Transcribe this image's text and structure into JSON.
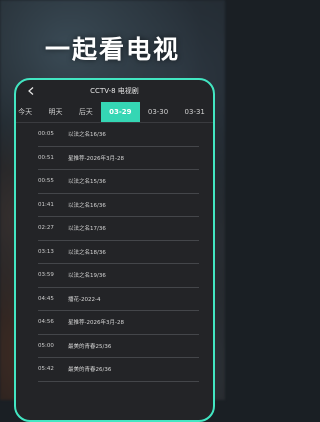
{
  "headline": "一起看电视",
  "header": {
    "title": "CCTV-8 电视剧"
  },
  "colors": {
    "accent": "#35d6b4",
    "border": "#42e6c2"
  },
  "tabs": [
    {
      "label": "今天"
    },
    {
      "label": "明天"
    },
    {
      "label": "后天"
    },
    {
      "label": "03-29",
      "active": true
    },
    {
      "label": "03-30"
    },
    {
      "label": "03-31"
    }
  ],
  "programs": [
    {
      "time": "00:05",
      "title": "以法之名16/36"
    },
    {
      "time": "00:51",
      "title": "星推荐-2026年3月-28"
    },
    {
      "time": "00:55",
      "title": "以法之名15/36"
    },
    {
      "time": "01:41",
      "title": "以法之名16/36"
    },
    {
      "time": "02:27",
      "title": "以法之名17/36"
    },
    {
      "time": "03:13",
      "title": "以法之名18/36"
    },
    {
      "time": "03:59",
      "title": "以法之名19/36"
    },
    {
      "time": "04:45",
      "title": "播花-2022-4"
    },
    {
      "time": "04:56",
      "title": "星推荐-2026年3月-28"
    },
    {
      "time": "05:00",
      "title": "最美的青春25/36"
    },
    {
      "time": "05:42",
      "title": "最美的青春26/36"
    }
  ],
  "icons": {
    "back": "back-arrow-icon"
  }
}
